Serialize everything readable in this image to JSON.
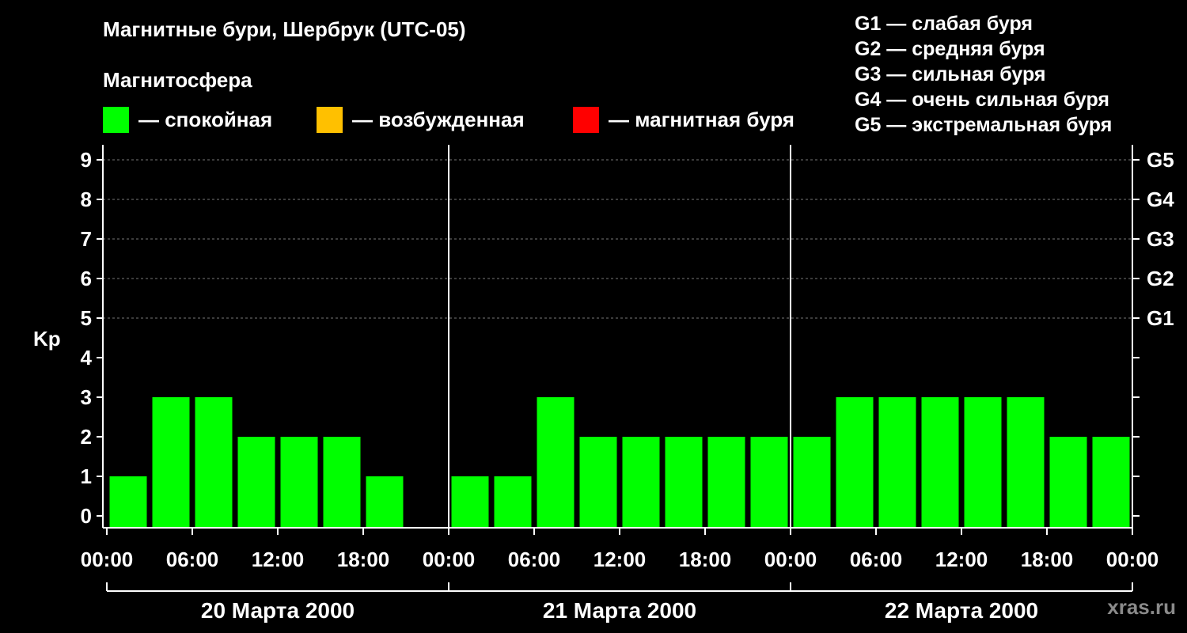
{
  "header": {
    "title": "Магнитные бури, Шербрук (UTC-05)",
    "subtitle": "Магнитосфера"
  },
  "legend": [
    {
      "color": "#00ff00",
      "label": "— спокойная"
    },
    {
      "color": "#ffc000",
      "label": "— возбужденная"
    },
    {
      "color": "#ff0000",
      "label": "— магнитная буря"
    }
  ],
  "storm_legend": [
    "G1 — слабая буря",
    "G2 — средняя буря",
    "G3 — сильная буря",
    "G4 — очень сильная буря",
    "G5 — экстремальная буря"
  ],
  "credit": "xras.ru",
  "chart_data": {
    "type": "bar",
    "ylabel": "Kp",
    "ylim": [
      0,
      9
    ],
    "yticks": [
      0,
      1,
      2,
      3,
      4,
      5,
      6,
      7,
      8,
      9
    ],
    "right_ticks": [
      {
        "value": 5,
        "label": "G1"
      },
      {
        "value": 6,
        "label": "G2"
      },
      {
        "value": 7,
        "label": "G3"
      },
      {
        "value": 8,
        "label": "G4"
      },
      {
        "value": 9,
        "label": "G5"
      }
    ],
    "xtick_labels": [
      "00:00",
      "06:00",
      "12:00",
      "18:00",
      "00:00",
      "06:00",
      "12:00",
      "18:00",
      "00:00",
      "06:00",
      "12:00",
      "18:00",
      "00:00"
    ],
    "days": [
      "20 Марта 2000",
      "21 Марта 2000",
      "22 Марта 2000"
    ],
    "interval_hours": 3,
    "values": [
      [
        1,
        3,
        3,
        2,
        2,
        2,
        1,
        null
      ],
      [
        1,
        1,
        3,
        2,
        2,
        2,
        2,
        2
      ],
      [
        2,
        3,
        3,
        3,
        3,
        3,
        2,
        2
      ]
    ],
    "bar_color": "#00ff00",
    "grid": true
  }
}
